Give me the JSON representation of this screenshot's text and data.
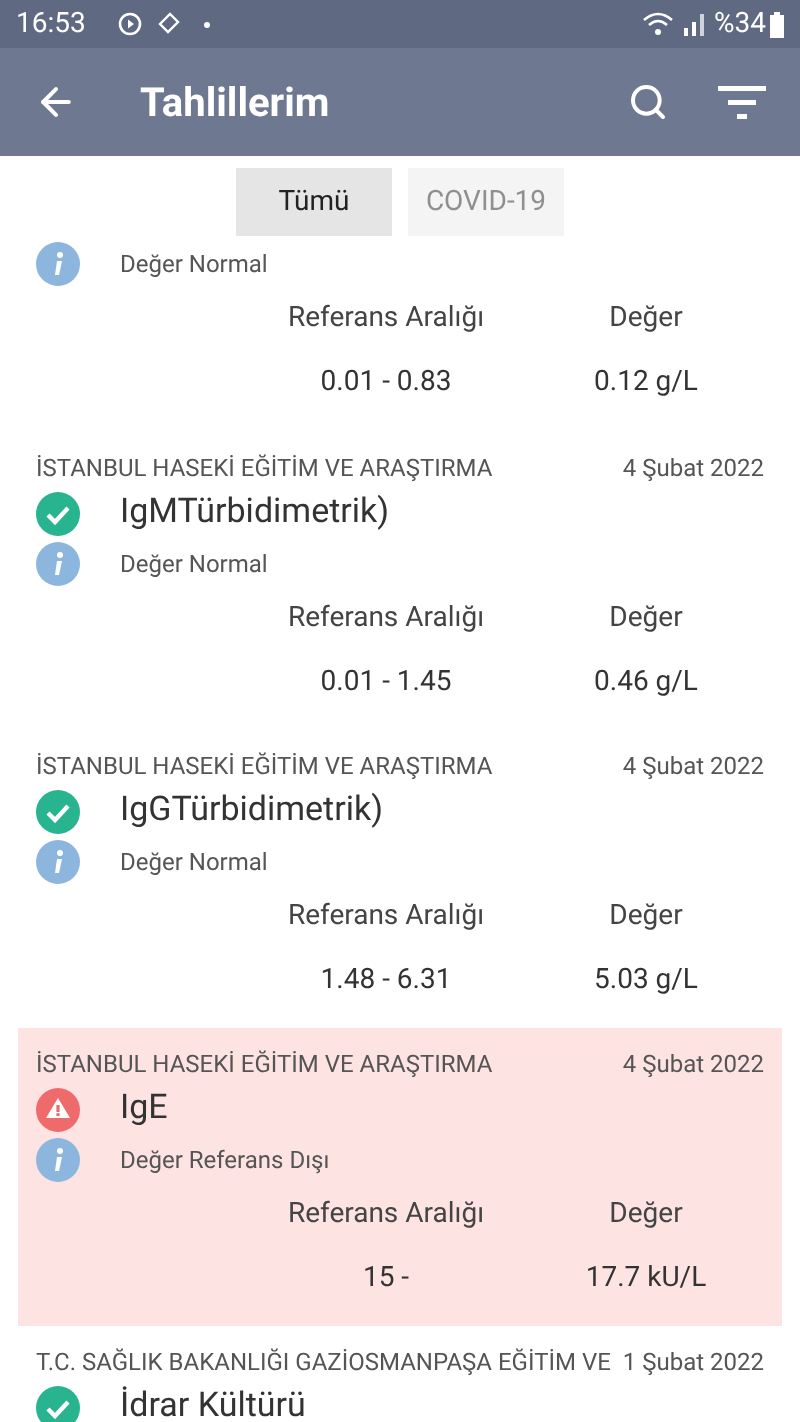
{
  "status_bar": {
    "time": "16:53",
    "battery": "%34"
  },
  "app_bar": {
    "title": "Tahlillerim"
  },
  "tabs": [
    {
      "label": "Tümü",
      "selected": true
    },
    {
      "label": "COVID-19",
      "selected": false
    }
  ],
  "results": [
    {
      "kind": "normal",
      "note": "Değer Normal",
      "range_label": "Referans Aralığı",
      "value_label": "Değer",
      "range": "0.01 - 0.83",
      "value": "0.12 g/L"
    },
    {
      "hospital": "İSTANBUL HASEKİ EĞİTİM VE ARAŞTIRMA",
      "date": "4 Şubat 2022",
      "name": "IgMTürbidimetrik)",
      "kind": "normal",
      "note": "Değer Normal",
      "range_label": "Referans Aralığı",
      "value_label": "Değer",
      "range": "0.01 - 1.45",
      "value": "0.46 g/L"
    },
    {
      "hospital": "İSTANBUL HASEKİ EĞİTİM VE ARAŞTIRMA",
      "date": "4 Şubat 2022",
      "name": "IgGTürbidimetrik)",
      "kind": "normal",
      "note": "Değer Normal",
      "range_label": "Referans Aralığı",
      "value_label": "Değer",
      "range": "1.48 - 6.31",
      "value": "5.03 g/L"
    },
    {
      "hospital": "İSTANBUL HASEKİ EĞİTİM VE ARAŞTIRMA",
      "date": "4 Şubat 2022",
      "name": "IgE",
      "kind": "abnormal",
      "note": "Değer Referans Dışı",
      "range_label": "Referans Aralığı",
      "value_label": "Değer",
      "range": "15 -",
      "value": "17.7 kU/L"
    },
    {
      "hospital": "T.C. SAĞLIK BAKANLIĞI GAZİOSMANPAŞA EĞİTİM VE",
      "date": "1 Şubat 2022",
      "name": "İdrar Kültürü",
      "kind": "normal"
    }
  ]
}
